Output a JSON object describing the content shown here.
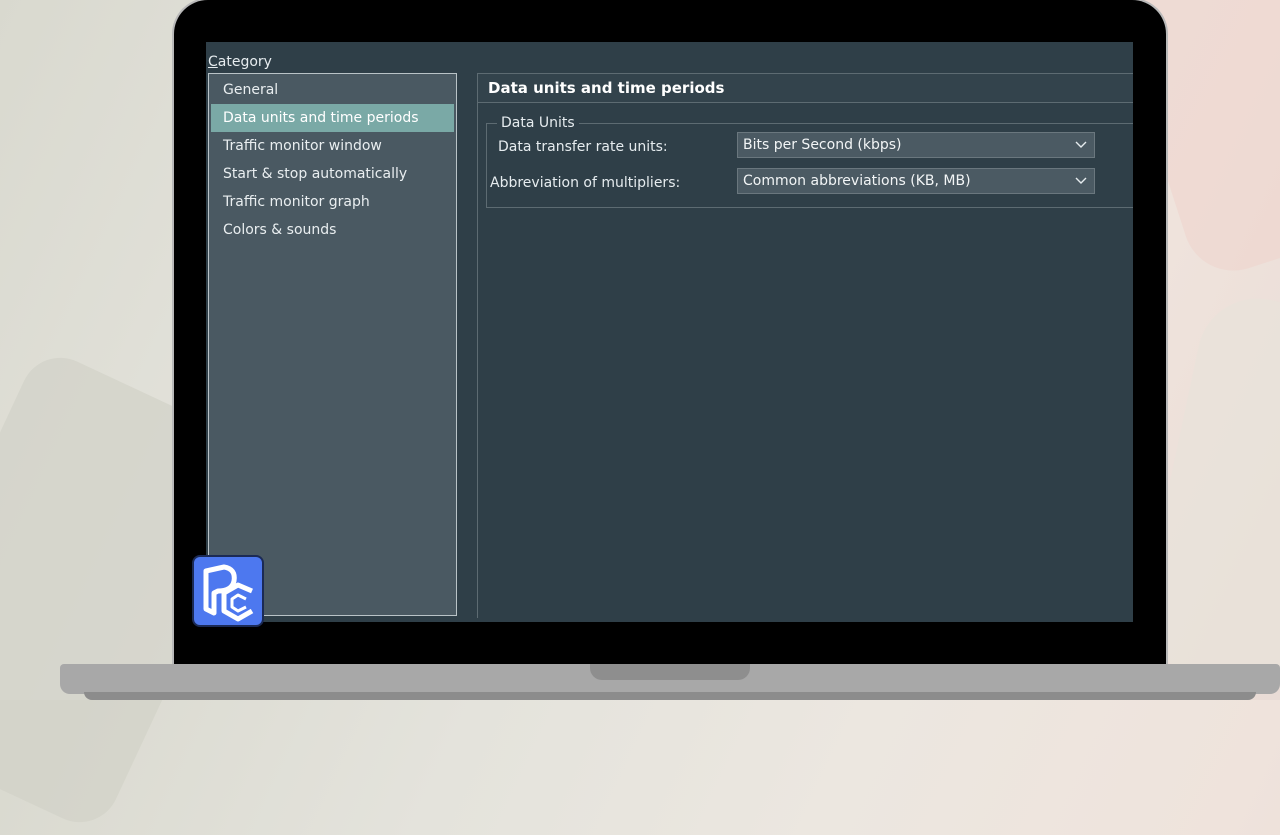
{
  "sidebar": {
    "label_prefix": "C",
    "label_rest": "ategory",
    "items": [
      {
        "label": "General"
      },
      {
        "label": "Data units and time periods"
      },
      {
        "label": "Traffic monitor window"
      },
      {
        "label": "Start & stop automatically"
      },
      {
        "label": "Traffic monitor graph"
      },
      {
        "label": "Colors & sounds"
      }
    ],
    "selected_index": 1
  },
  "panel": {
    "title": "Data units and time periods",
    "group": {
      "title": "Data Units",
      "fields": [
        {
          "label": "Data transfer rate units:",
          "value": "Bits per Second (kbps)"
        },
        {
          "label": "Abbreviation of multipliers:",
          "value": "Common abbreviations (KB, MB)"
        }
      ]
    }
  },
  "colors": {
    "selection": "#7aa9a6",
    "panel_bg": "#2f3f48",
    "list_bg": "#4a5962",
    "logo_blue": "#4d78ef"
  },
  "icons": {
    "dropdown": "chevron-down-icon",
    "logo": "app-logo-icon"
  }
}
